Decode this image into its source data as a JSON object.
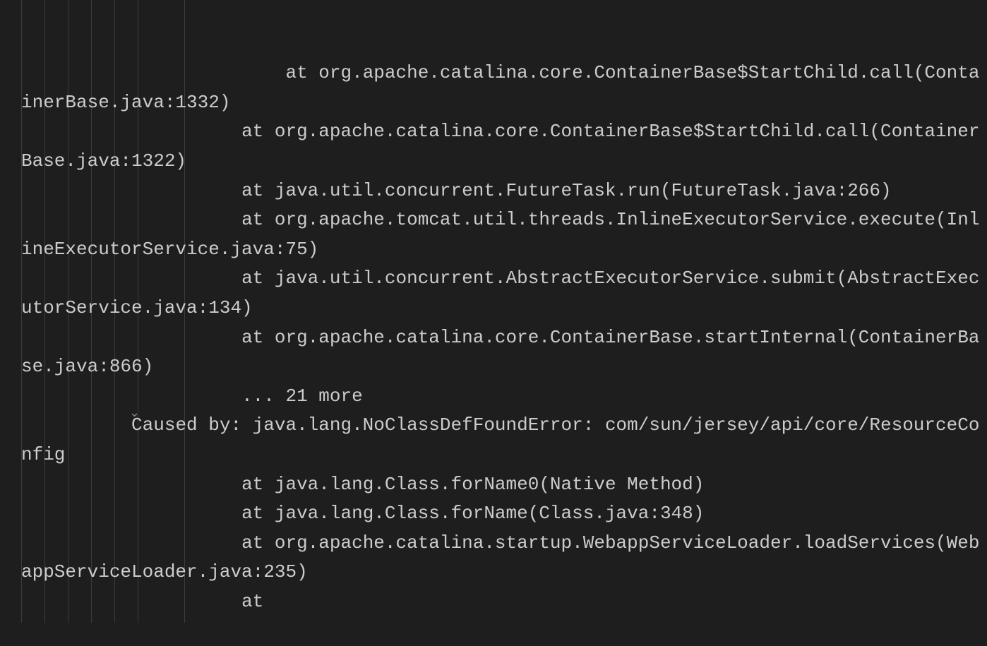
{
  "indentGuidePositions": [
    30,
    63,
    96,
    129,
    162,
    195,
    261
  ],
  "foldCaret": {
    "glyph": "⌄",
    "topPx": 572
  },
  "codeText": "                    at org.apache.catalina.core.ContainerBase$StartChild.call(ContainerBase.java:1332)\n                    at org.apache.catalina.core.ContainerBase$StartChild.call(ContainerBase.java:1322)\n                    at java.util.concurrent.FutureTask.run(FutureTask.java:266)\n                    at org.apache.tomcat.util.threads.InlineExecutorService.execute(InlineExecutorService.java:75)\n                    at java.util.concurrent.AbstractExecutorService.submit(AbstractExecutorService.java:134)\n                    at org.apache.catalina.core.ContainerBase.startInternal(ContainerBase.java:866)\n                    ... 21 more\n          Caused by: java.lang.NoClassDefFoundError: com/sun/jersey/api/core/ResourceConfig\n                    at java.lang.Class.forName0(Native Method)\n                    at java.lang.Class.forName(Class.java:348)\n                    at org.apache.catalina.startup.WebappServiceLoader.loadServices(WebappServiceLoader.java:235)\n                    at"
}
